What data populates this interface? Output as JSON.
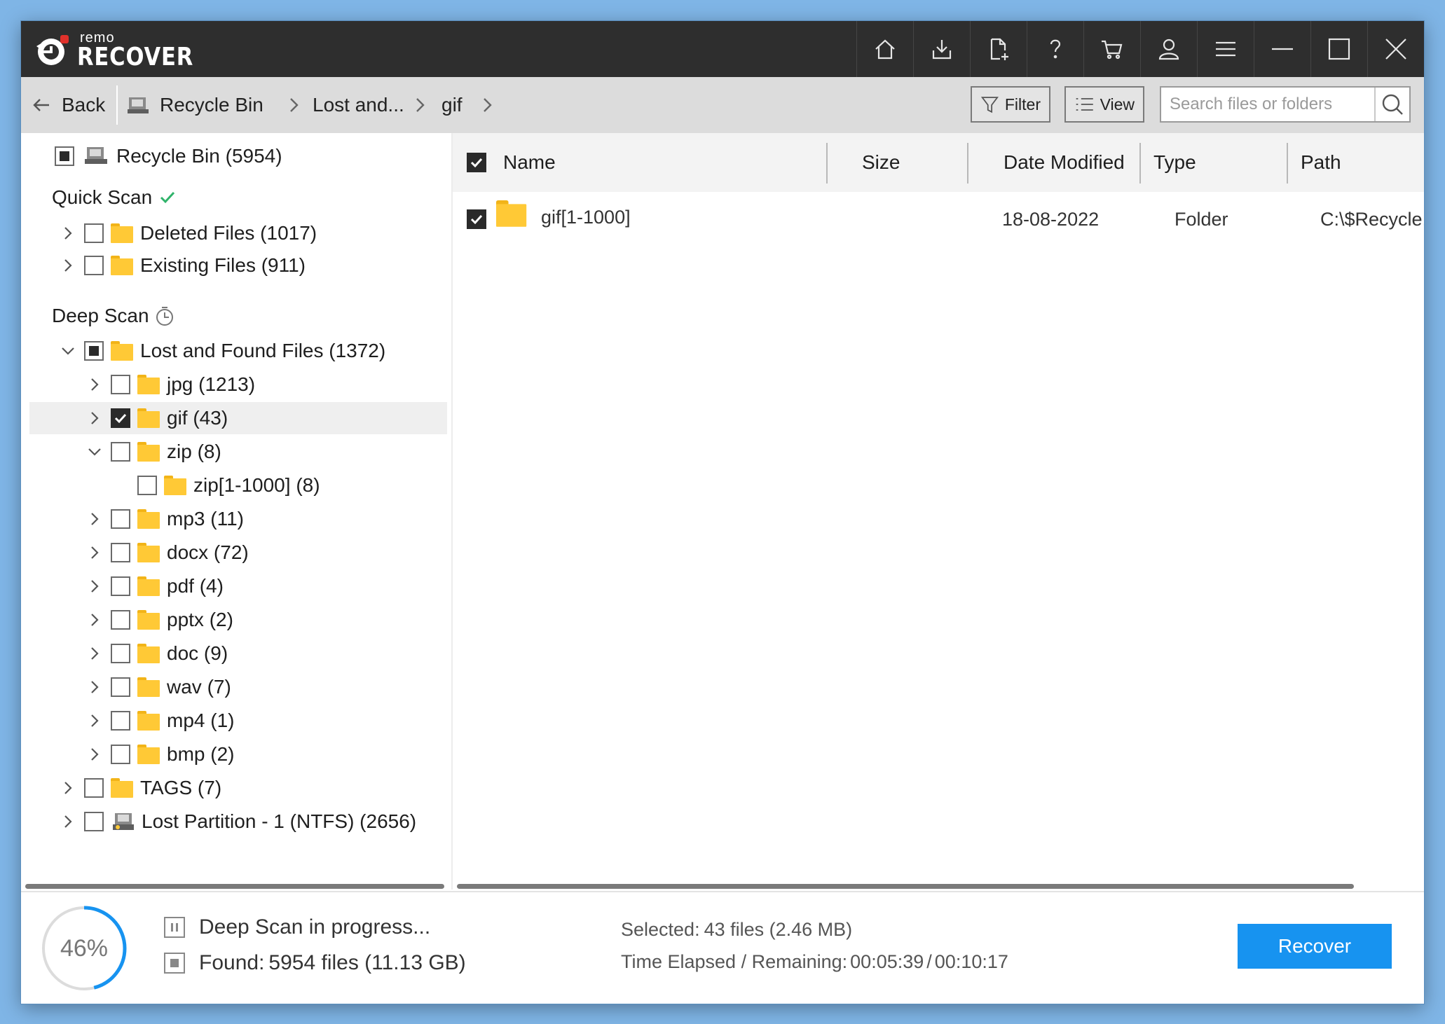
{
  "app": {
    "logo_small": "remo",
    "logo_big": "RECOVER"
  },
  "titlebar_icons": [
    "home-icon",
    "download-icon",
    "file-add-icon",
    "help-icon",
    "cart-icon",
    "user-icon",
    "menu-icon",
    "minimize-icon",
    "maximize-icon",
    "close-icon"
  ],
  "nav": {
    "back_label": "Back",
    "crumbs": [
      "Recycle Bin",
      "Lost and...",
      "gif"
    ],
    "filter_label": "Filter",
    "view_label": "View",
    "search_placeholder": "Search files or folders"
  },
  "tree": {
    "root": "Recycle Bin (5954)",
    "quick_scan_label": "Quick Scan",
    "quick_items": [
      "Deleted Files (1017)",
      "Existing Files (911)"
    ],
    "deep_scan_label": "Deep Scan",
    "lost_found": "Lost and Found Files (1372)",
    "children": [
      {
        "label": "jpg (1213)",
        "checked": false,
        "expanded": false
      },
      {
        "label": "gif (43)",
        "checked": true,
        "expanded": false
      },
      {
        "label": "zip (8)",
        "checked": false,
        "expanded": true
      },
      {
        "label": "zip[1-1000] (8)",
        "checked": false,
        "sub": true
      },
      {
        "label": "mp3 (11)",
        "checked": false
      },
      {
        "label": "docx (72)",
        "checked": false
      },
      {
        "label": "pdf (4)",
        "checked": false
      },
      {
        "label": "pptx (2)",
        "checked": false
      },
      {
        "label": "doc (9)",
        "checked": false
      },
      {
        "label": "wav (7)",
        "checked": false
      },
      {
        "label": "mp4 (1)",
        "checked": false
      },
      {
        "label": "bmp (2)",
        "checked": false
      }
    ],
    "tags": "TAGS (7)",
    "lost_partition": "Lost Partition - 1 (NTFS) (2656)"
  },
  "table": {
    "headers": {
      "name": "Name",
      "size": "Size",
      "date": "Date Modified",
      "type": "Type",
      "path": "Path"
    },
    "rows": [
      {
        "name": "gif[1-1000]",
        "size": "",
        "date": "18-08-2022",
        "type": "Folder",
        "path": "C:\\$Recycle.Bin"
      }
    ]
  },
  "status": {
    "progress_percent": 46,
    "progress_label": "46%",
    "scan_state": "Deep Scan in progress...",
    "found_label": "Found:",
    "found_value": "5954 files (11.13 GB)",
    "selected_label": "Selected:",
    "selected_value": "43 files (2.46 MB)",
    "time_label": "Time Elapsed / Remaining:",
    "elapsed": "00:05:39",
    "time_sep": "/",
    "remaining": "00:10:17",
    "recover_label": "Recover"
  },
  "colors": {
    "titlebar": "#2e2e2e",
    "accent": "#1793f0",
    "folder": "#ffc936",
    "check_green": "#2fb36a"
  }
}
